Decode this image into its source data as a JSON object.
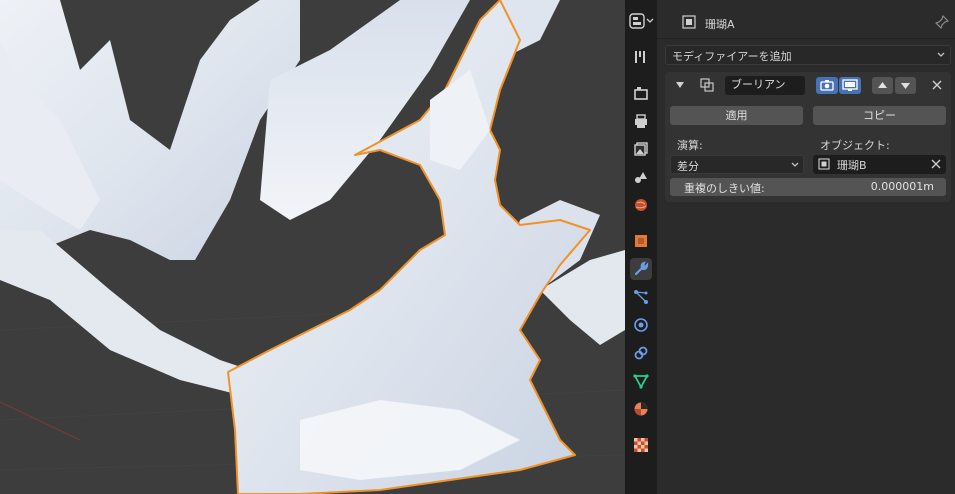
{
  "header": {
    "object_name": "珊瑚A"
  },
  "add_modifier": {
    "label": "モディファイアーを追加"
  },
  "modifier": {
    "name": "ブーリアン",
    "apply_label": "適用",
    "copy_label": "コピー",
    "operation_label": "演算:",
    "operation_value": "差分",
    "object_label": "オブジェクト:",
    "object_value": "珊瑚B",
    "threshold_label": "重複のしきい値:",
    "threshold_value": "0.000001m"
  },
  "colors": {
    "accent": "#4772b3",
    "selection_outline": "#f0922a",
    "panel_bg": "#2b2b2b",
    "tabs_bg": "#1d1d1d"
  },
  "tabs": [
    {
      "name": "tool-tab-icon"
    },
    {
      "name": "render-tab-icon"
    },
    {
      "name": "output-tab-icon"
    },
    {
      "name": "view-layer-tab-icon"
    },
    {
      "name": "scene-tab-icon"
    },
    {
      "name": "world-tab-icon"
    },
    {
      "name": "object-tab-icon"
    },
    {
      "name": "modifier-tab-icon"
    },
    {
      "name": "particles-tab-icon"
    },
    {
      "name": "physics-tab-icon"
    },
    {
      "name": "constraints-tab-icon"
    },
    {
      "name": "data-tab-icon"
    },
    {
      "name": "material-tab-icon"
    },
    {
      "name": "texture-tab-icon"
    }
  ]
}
